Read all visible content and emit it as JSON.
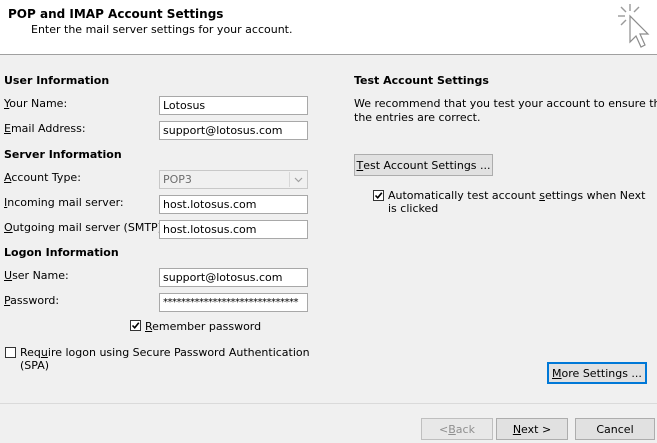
{
  "header": {
    "title": "POP and IMAP Account Settings",
    "subtitle": "Enter the mail server settings for your account."
  },
  "user_info": {
    "heading": "User Information",
    "name_label_u": "Y",
    "name_label_rest": "our Name:",
    "name_value": "Lotosus",
    "email_label_u": "E",
    "email_label_rest": "mail Address:",
    "email_value": "support@lotosus.com"
  },
  "server_info": {
    "heading": "Server Information",
    "account_type_label_u": "A",
    "account_type_label_rest": "ccount Type:",
    "account_type_value": "POP3",
    "incoming_label_u": "I",
    "incoming_label_rest": "ncoming mail server:",
    "incoming_value": "host.lotosus.com",
    "outgoing_label_u": "O",
    "outgoing_label_rest": "utgoing mail server (SMTP):",
    "outgoing_value": "host.lotosus.com"
  },
  "logon_info": {
    "heading": "Logon Information",
    "username_label_u": "U",
    "username_label_rest": "ser Name:",
    "username_value": "support@lotosus.com",
    "password_label_u": "P",
    "password_label_rest": "assword:",
    "password_value": "******************************",
    "remember_label_u": "R",
    "remember_label_rest": "emember password",
    "remember_checked": true,
    "spa_label_pre": "Req",
    "spa_label_u": "u",
    "spa_label_rest": "ire logon using Secure Password Authentication",
    "spa_label_line2": "(SPA)",
    "spa_checked": false
  },
  "test_settings": {
    "heading": "Test Account Settings",
    "description_line1": "We recommend that you test your account to ensure that",
    "description_line2": "the entries are correct.",
    "button_u": "T",
    "button_rest": "est Account Settings ...",
    "auto_label_pre": "Automatically test account ",
    "auto_label_u": "s",
    "auto_label_rest": "ettings when Next",
    "auto_label_line2": "is clicked",
    "auto_checked": true
  },
  "buttons": {
    "more_u": "M",
    "more_rest": "ore Settings ...",
    "back_pre": "< ",
    "back_u": "B",
    "back_rest": "ack",
    "next_u": "N",
    "next_rest": "ext >",
    "cancel": "Cancel"
  },
  "icons": {
    "header_icon": "cursor-click-icon",
    "dropdown": "chevron-down-icon",
    "check": "checkmark-icon"
  }
}
